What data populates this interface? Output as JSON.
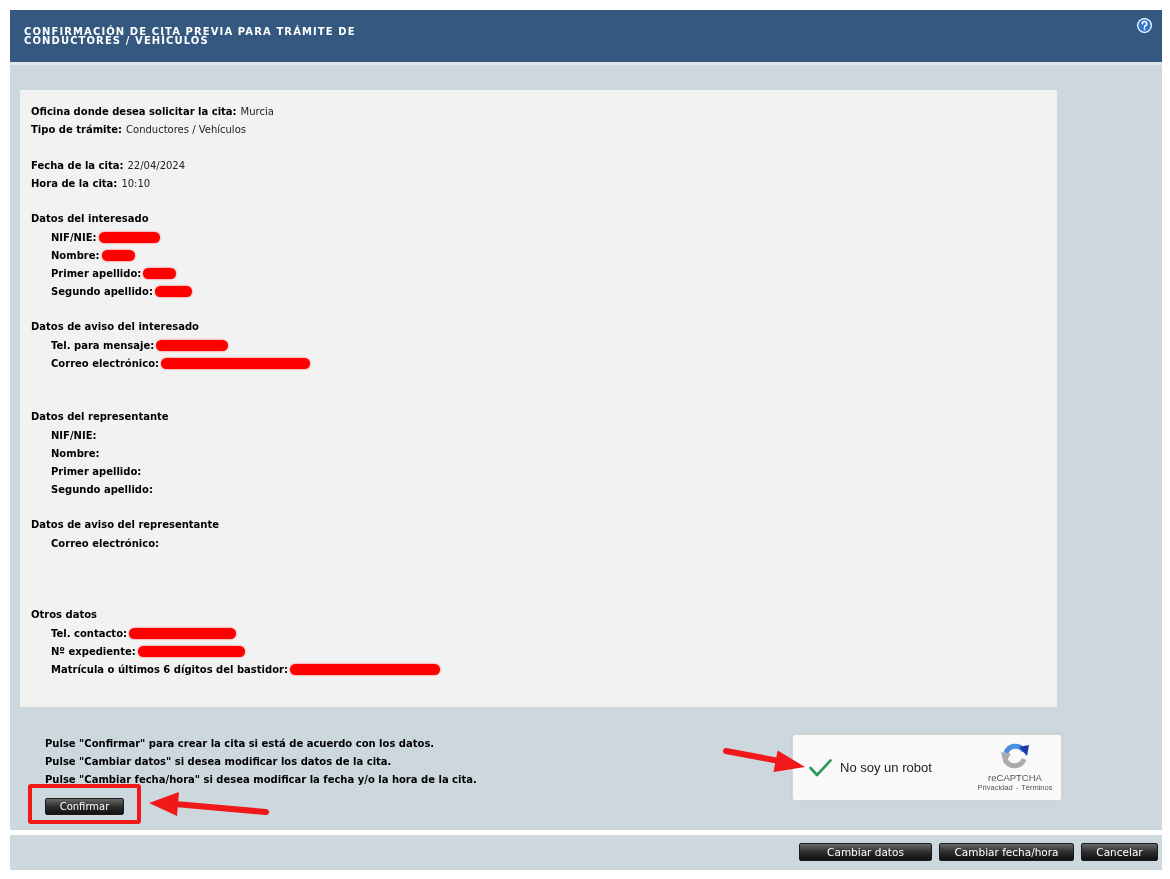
{
  "header": {
    "title": "CONFIRMACIÓN DE CITA PREVIA PARA TRÁMITE DE CONDUCTORES / VEHÍCULOS"
  },
  "summary": {
    "sections": [
      {
        "items": [
          {
            "label": "Oficina donde desea solicitar la cita:",
            "value": "Murcia",
            "redacted": false
          },
          {
            "label": "Tipo de trámite:",
            "value": "Conductores / Vehículos",
            "redacted": false
          }
        ]
      },
      {
        "items": [
          {
            "label": "Fecha de la cita:",
            "value": "22/04/2024",
            "redacted": false
          },
          {
            "label": "Hora de la cita:",
            "value": "10:10",
            "redacted": false
          }
        ]
      },
      {
        "heading": "Datos del interesado",
        "items": [
          {
            "label": "NIF/NIE:",
            "redacted": true
          },
          {
            "label": "Nombre:",
            "redacted": true
          },
          {
            "label": "Primer apellido:",
            "redacted": true
          },
          {
            "label": "Segundo apellido:",
            "redacted": true
          }
        ]
      },
      {
        "heading": "Datos de aviso del interesado",
        "items": [
          {
            "label": "Tel. para mensaje:",
            "redacted": true
          },
          {
            "label": "Correo electrónico:",
            "redacted": true
          }
        ]
      },
      {
        "heading": "Datos del representante",
        "items": [
          {
            "label": "NIF/NIE:",
            "redacted": false
          },
          {
            "label": "Nombre:",
            "redacted": false
          },
          {
            "label": "Primer apellido:",
            "redacted": false
          },
          {
            "label": "Segundo apellido:",
            "redacted": false
          }
        ]
      },
      {
        "heading": "Datos de aviso del representante",
        "items": [
          {
            "label": "Correo electrónico:",
            "redacted": false
          }
        ]
      },
      {
        "heading": "Otros datos",
        "items": [
          {
            "label": "Tel. contacto:",
            "redacted": true
          },
          {
            "label": "Nº expediente:",
            "redacted": true
          },
          {
            "label": "Matrícula o últimos 6 dígitos del bastidor:",
            "redacted": true
          }
        ]
      }
    ]
  },
  "instructions": [
    "Pulse \"Confirmar\" para crear la cita si está de acuerdo con los datos.",
    "Pulse \"Cambiar datos\" si desea modificar los datos de la cita.",
    "Pulse \"Cambiar fecha/hora\" si desea modificar la fecha y/o la hora de la cita."
  ],
  "confirm_button": {
    "label": "Confirmar",
    "highlighted": true,
    "pointed_at": true
  },
  "captcha": {
    "label": "No soy un robot",
    "checked": true,
    "pointed_at": true,
    "brand": "reCAPTCHA",
    "links": [
      "Privacidad",
      "Términos"
    ],
    "link_separator": "-"
  },
  "footer_buttons": [
    "Cambiar datos",
    "Cambiar fecha/hora",
    "Cancelar"
  ]
}
